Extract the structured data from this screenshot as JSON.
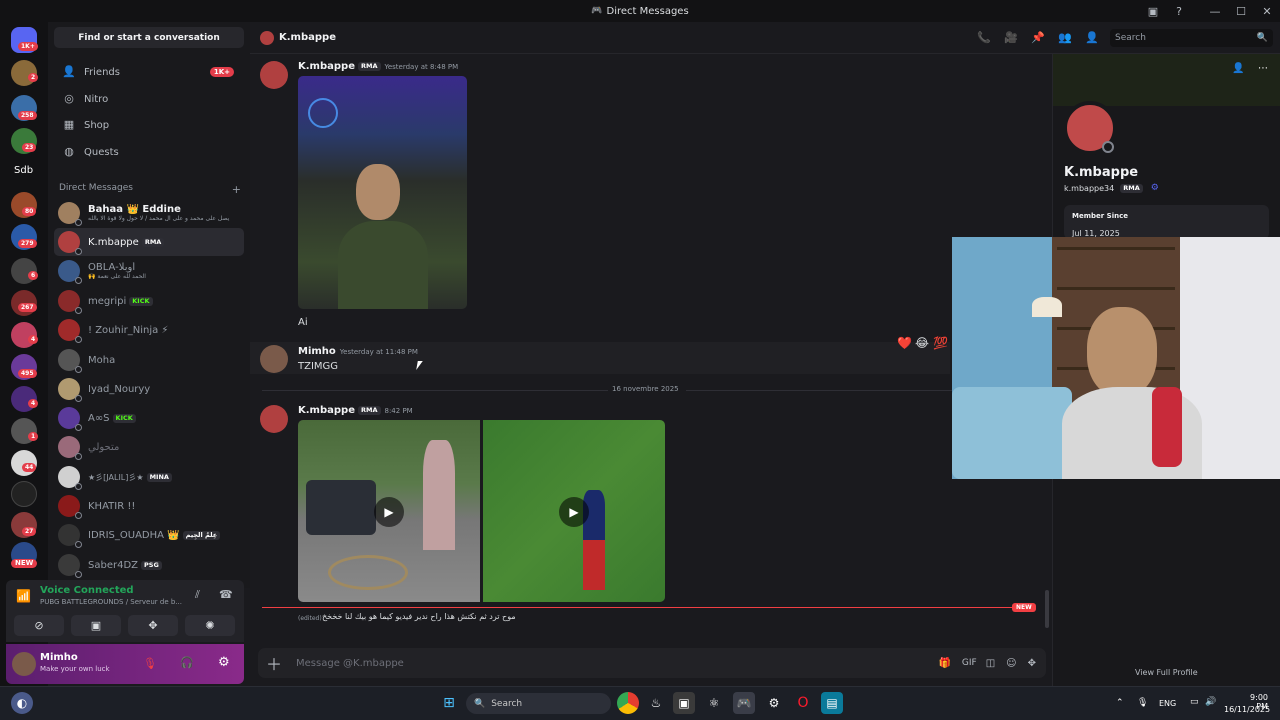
{
  "window": {
    "title": "Direct Messages"
  },
  "servers": {
    "badges": [
      "1K+",
      "2",
      "258",
      "23",
      "Sdb",
      "80",
      "279",
      "6",
      "267",
      "4",
      "495",
      "4",
      "1",
      "44",
      "27",
      "NEW"
    ]
  },
  "sidebar": {
    "find_button": "Find or start a conversation",
    "nav": [
      {
        "label": "Friends",
        "badge": "1K+",
        "icon": "friends-icon"
      },
      {
        "label": "Nitro",
        "icon": "nitro-icon"
      },
      {
        "label": "Shop",
        "icon": "shop-icon"
      },
      {
        "label": "Quests",
        "icon": "quests-icon"
      }
    ],
    "dm_header": "Direct Messages",
    "dm_add": "+",
    "dms": [
      {
        "name": "Bahaa 👑 Eddine",
        "status": "يصل على محمد و على ال محمد / لا حول ولا قوة الا بالله"
      },
      {
        "name": "K.mbappe",
        "tag": "RMA"
      },
      {
        "name": "OBLA-أوبلا",
        "status": "🙌 الحمد لله على نعمة"
      },
      {
        "name": "megripi",
        "tag": "KICK"
      },
      {
        "name": "! Zouhir_Ninja ⚡"
      },
      {
        "name": "Moha"
      },
      {
        "name": "Iyad_Nouryy"
      },
      {
        "name": "A∞S",
        "tag": "KICK"
      },
      {
        "name": "متحولي"
      },
      {
        "name": "★彡[JALIL]彡★",
        "tag": "MINA"
      },
      {
        "name": "KHATIR !!"
      },
      {
        "name": "IDRIS_OUADHA 👑",
        "tag": "عِلمُ الجِيم"
      },
      {
        "name": "Saber4DZ",
        "tag": "PSG"
      }
    ]
  },
  "voice": {
    "status": "Voice Connected",
    "channel": "PUBG BATTLEGROUNDS / Serveur de b..."
  },
  "user": {
    "name": "Mimho",
    "status": "Make your own luck"
  },
  "chat": {
    "header_name": "K.mbappe",
    "search_placeholder": "Search",
    "messages": [
      {
        "author": "K.mbappe",
        "tag": "RMA",
        "time": "Yesterday at 8:48 PM",
        "text": "Ai"
      },
      {
        "author": "Mimho",
        "time": "Yesterday at 11:48 PM",
        "text": "TZIMGG",
        "reactions": [
          "❤️",
          "😂",
          "💯"
        ]
      },
      {
        "author": "K.mbappe",
        "tag": "RMA",
        "time": "8:42 PM",
        "edited": "(edited)",
        "text": "موح ترد ثم نكتش هذا راح ندير فيديو كيما هو بيك لنا خخخخ"
      }
    ],
    "date_divider": "16 novembre 2025",
    "new_marker": "NEW",
    "composer_placeholder": "Message @K.mbappe"
  },
  "profile": {
    "name": "K.mbappe",
    "username": "k.mbappe34",
    "tag": "RMA",
    "member_since_label": "Member Since",
    "member_since": "Jul 11, 2025",
    "view_full": "View Full Profile"
  },
  "taskbar": {
    "search": "Search",
    "lang": "ENG",
    "time": "9:00 PM",
    "date": "16/11/2025"
  }
}
